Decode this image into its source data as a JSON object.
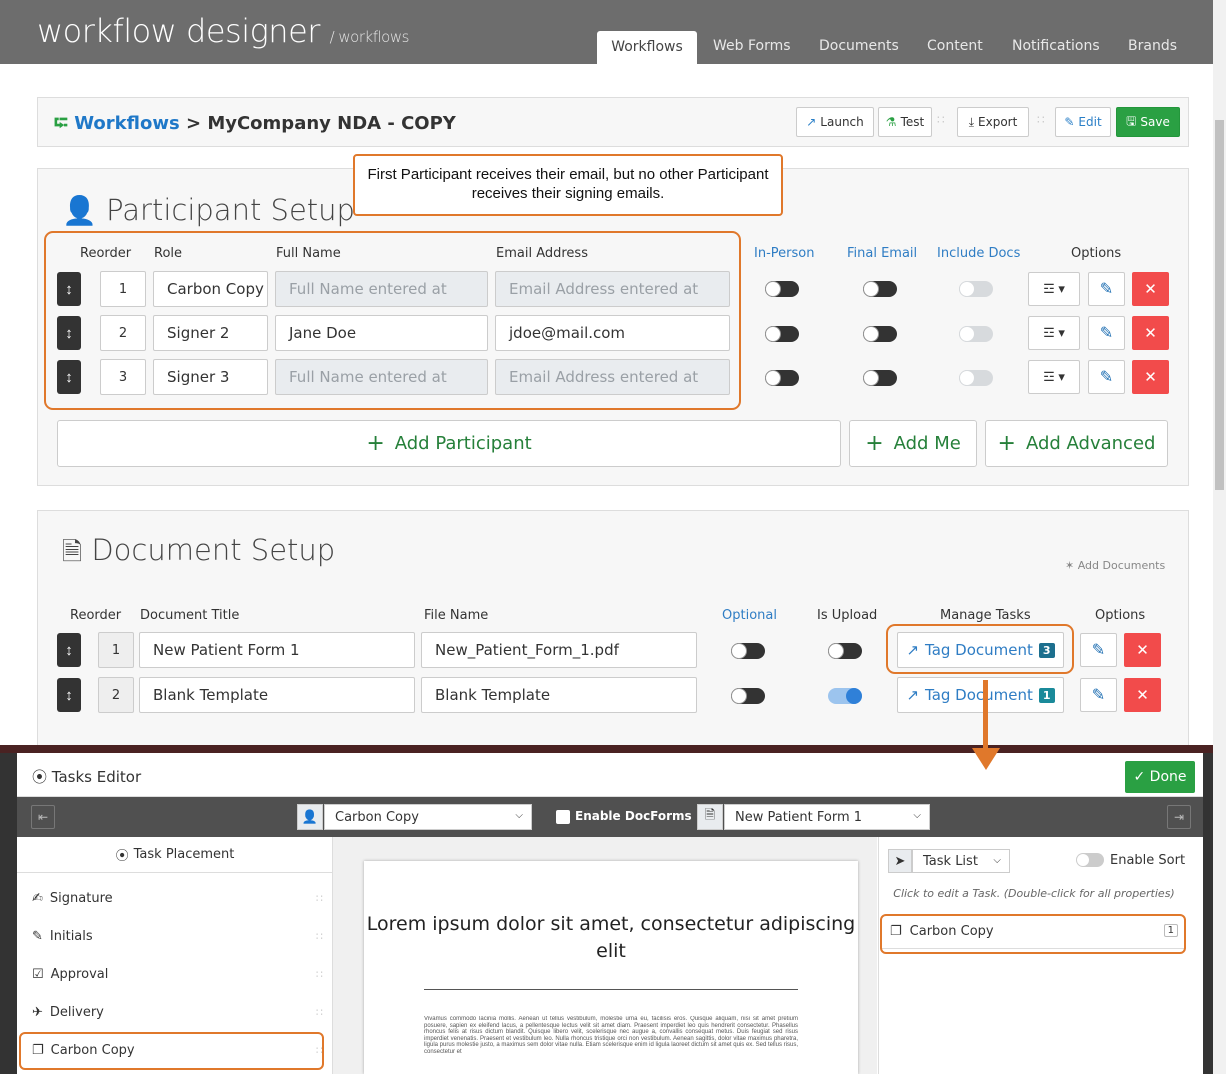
{
  "app": {
    "title": "workflow designer",
    "subtitle": "/ workflows"
  },
  "nav": [
    "Workflows",
    "Web Forms",
    "Documents",
    "Content",
    "Notifications",
    "Brands"
  ],
  "breadcrumb": {
    "link": "Workflows",
    "sep": ">",
    "current": "MyCompany NDA - COPY"
  },
  "toolbar": {
    "launch": "Launch",
    "test": "Test",
    "export": "Export",
    "edit": "Edit",
    "save": "Save"
  },
  "annotation": "First Participant receives their email, but no other Participant receives their signing emails.",
  "participant_setup": {
    "title": "Participant Setup",
    "headers": {
      "reorder": "Reorder",
      "role": "Role",
      "full_name": "Full Name",
      "email": "Email Address",
      "in_person": "In-Person",
      "final_email": "Final Email",
      "include_docs": "Include Docs",
      "options": "Options"
    },
    "rows": [
      {
        "order": "1",
        "role": "Carbon Copy",
        "full_name": "Full Name entered at",
        "email": "Email Address entered at"
      },
      {
        "order": "2",
        "role": "Signer 2",
        "full_name": "Jane Doe",
        "email": "jdoe@mail.com"
      },
      {
        "order": "3",
        "role": "Signer 3",
        "full_name": "Full Name entered at",
        "email": "Email Address entered at"
      }
    ],
    "add_participant": "Add Participant",
    "add_me": "Add Me",
    "add_advanced": "Add Advanced"
  },
  "document_setup": {
    "title": "Document Setup",
    "add_documents": "Add Documents",
    "headers": {
      "reorder": "Reorder",
      "title": "Document Title",
      "file": "File Name",
      "optional": "Optional",
      "is_upload": "Is Upload",
      "manage": "Manage Tasks",
      "options": "Options"
    },
    "rows": [
      {
        "order": "1",
        "title": "New Patient Form 1",
        "file": "New_Patient_Form_1.pdf",
        "tag": "Tag Document",
        "count": "3"
      },
      {
        "order": "2",
        "title": "Blank Template",
        "file": "Blank Template",
        "tag": "Tag Document",
        "count": "1"
      }
    ]
  },
  "tasks_editor": {
    "title": "Tasks Editor",
    "done": "Done",
    "participant_select": "Carbon Copy",
    "enable_docforms": "Enable DocForms",
    "document_select": "New Patient Form 1",
    "task_placement": "Task Placement",
    "tasks": [
      "Signature",
      "Initials",
      "Approval",
      "Delivery",
      "Carbon Copy"
    ],
    "task_list_select": "Task List",
    "enable_sort": "Enable Sort",
    "hint": "Click to edit a Task. (Double-click for all properties)",
    "task_item": "Carbon Copy",
    "task_item_count": "1",
    "page_title": "Lorem ipsum dolor sit amet, consectetur adipiscing elit",
    "page_body": "Vivamus commodo lacinia mollis. Aenean ut tellus vestibulum, molestie urna eu, facilisis eros. Quisque aliquam, nisi sit amet pretium posuere, sapien ex eleifend lacus, a pellentesque lectus velit sit amet diam. Praesent imperdiet leo quis hendrerit consectetur. Phasellus rhoncus felis at risus dictum blandit. Quisque libero velit, scelerisque nec augue a, convallis consequat metus. Duis feugiat sed risus imperdiet venenatis. Praesent et vestibulum leo. Nulla rhoncus tristique orci non vestibulum. Aenean sagittis, dolor vitae maximus pharetra, ligula purus molestie justo, a maximus sem dolor vitae nulla. Etiam scelerisque enim id ligula laoreet dictum sit amet quis ex. Sed tellus risus, consectetur et"
  },
  "colors": {
    "accent_orange": "#e0782b",
    "save_green": "#2aa043",
    "delete_red": "#f24b4b",
    "link_blue": "#1f78c8"
  }
}
